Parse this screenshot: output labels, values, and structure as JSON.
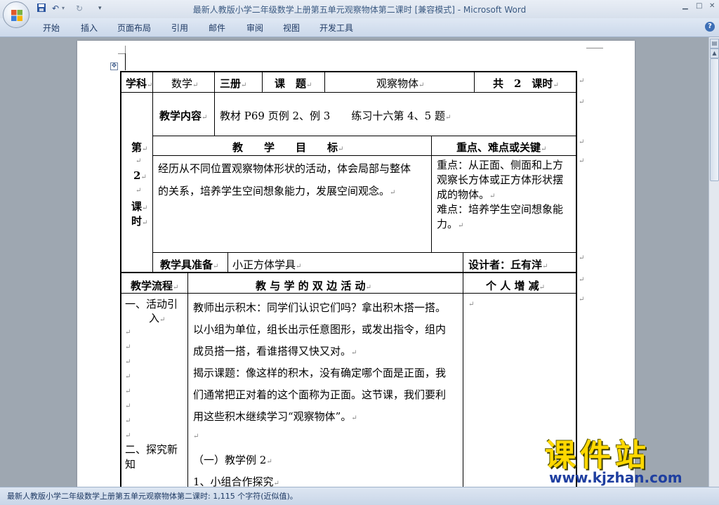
{
  "window": {
    "title": "最新人教版小学二年级数学上册第五单元观察物体第二课时 [兼容模式] - Microsoft Word",
    "minimize": "▁",
    "maximize": "□",
    "close": "✕"
  },
  "ribbon": {
    "tabs": [
      "开始",
      "插入",
      "页面布局",
      "引用",
      "邮件",
      "审阅",
      "视图",
      "开发工具"
    ],
    "help": "?"
  },
  "document": {
    "row1": {
      "subject_label": "学科",
      "subject": "数学",
      "volume": "三册",
      "topic_label": "课　题",
      "topic": "观察物体",
      "total": "共　2　课时"
    },
    "lesson_label": [
      "第",
      "2",
      "课",
      "时"
    ],
    "content_label": "教学内容",
    "content": "教材 P69 页例 2、例 3　　练习十六第 4、5 题",
    "goals_header": "教　　学　　目　　标",
    "key_header": "重点、难点或关键",
    "goals_lines": [
      "经历从不同位置观察物体形状的活动，体会局部与整体",
      "的关系，培养学生空间想象能力，发展空间观念。"
    ],
    "key_lines": [
      "重点：从正面、侧面和上方",
      "观察长方体或正方体形状摆",
      "成的物体。",
      "难点：培养学生空间想象能",
      "力。"
    ],
    "tools_label": "教学具准备",
    "tools": "小正方体学具",
    "designer": "设计者：丘有洋",
    "flow_header": "教学流程",
    "activity_header": "教 与 学 的 双 边 活 动",
    "personal_header": "个 人 增 减",
    "step1": [
      "一、活动引",
      "入"
    ],
    "step2": [
      "二、探究新",
      "知"
    ],
    "activity_lines": [
      "教师出示积木：同学们认识它们吗？拿出积木搭一搭。",
      "以小组为单位，组长出示任意图形，或发出指令，组内",
      "成员搭一搭，看谁搭得又快又对。",
      "揭示课题：像这样的积木，没有确定哪个面是正面，我",
      "们通常把正对着的这个面称为正面。这节课，我们要利",
      "用这些积木继续学习“观察物体”。",
      "",
      "（一）教学例 2",
      "1、小组合作探究"
    ],
    "mark": "↵"
  },
  "status": {
    "text": "最新人教版小学二年级数学上册第五单元观察物体第二课时: 1,115 个字符(近似值)。"
  },
  "watermark": {
    "title": "课件站",
    "url": "www.kjzhan.com"
  }
}
